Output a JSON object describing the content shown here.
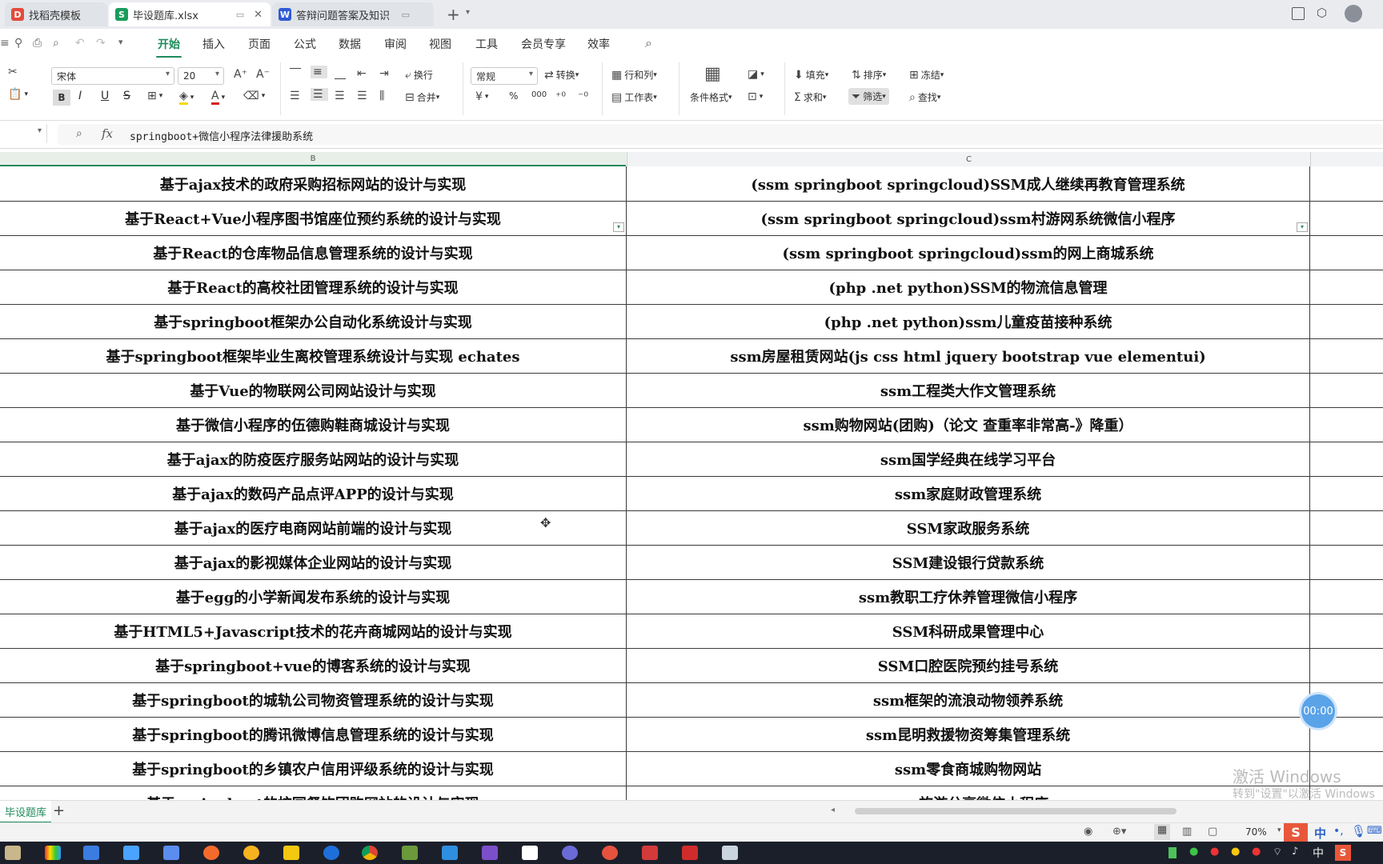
{
  "tabs": [
    {
      "label": "找稻壳模板",
      "icon": "D"
    },
    {
      "label": "毕设题库.xlsx",
      "icon": "S"
    },
    {
      "label": "答辩问题答案及知识",
      "icon": "W"
    }
  ],
  "menu": [
    "开始",
    "插入",
    "页面",
    "公式",
    "数据",
    "审阅",
    "视图",
    "工具",
    "会员专享",
    "效率"
  ],
  "ribbon": {
    "font_name": "宋体",
    "font_size": "20",
    "wrap": "换行",
    "merge": "合并",
    "number_format": "常规",
    "convert": "转换",
    "rows_cols": "行和列",
    "worksheet": "工作表",
    "cond_format": "条件格式",
    "fill": "填充",
    "sort": "排序",
    "freeze": "冻结",
    "sum": "求和",
    "filter": "筛选",
    "find": "查找",
    "bold": "B",
    "italic": "I",
    "underline": "U",
    "strike": "S",
    "currency": "¥",
    "percent": "%",
    "thousands": "000"
  },
  "formula": {
    "fx": "fx",
    "content": "springboot+微信小程序法律援助系统"
  },
  "columns": {
    "b": "B",
    "c": "C"
  },
  "rows": [
    {
      "b": "基于ajax技术的政府采购招标网站的设计与实现",
      "c": "(ssm springboot springcloud)SSM成人继续再教育管理系统"
    },
    {
      "b": "基于React+Vue小程序图书馆座位预约系统的设计与实现",
      "c": "(ssm springboot springcloud)ssm村游网系统微信小程序"
    },
    {
      "b": "基于React的仓库物品信息管理系统的设计与实现",
      "c": "(ssm springboot springcloud)ssm的网上商城系统"
    },
    {
      "b": "基于React的高校社团管理系统的设计与实现",
      "c": "(php .net python)SSM的物流信息管理"
    },
    {
      "b": "基于springboot框架办公自动化系统设计与实现",
      "c": "(php .net python)ssm儿童疫苗接种系统"
    },
    {
      "b": "基于springboot框架毕业生离校管理系统设计与实现 echates",
      "c": "ssm房屋租赁网站(js css html jquery bootstrap vue elementui)"
    },
    {
      "b": "基于Vue的物联网公司网站设计与实现",
      "c": "ssm工程类大作文管理系统"
    },
    {
      "b": "基于微信小程序的伍德购鞋商城设计与实现",
      "c": "ssm购物网站(团购)（论文 查重率非常高-》降重）"
    },
    {
      "b": "基于ajax的防疫医疗服务站网站的设计与实现",
      "c": "ssm国学经典在线学习平台"
    },
    {
      "b": "基于ajax的数码产品点评APP的设计与实现",
      "c": "ssm家庭财政管理系统"
    },
    {
      "b": "基于ajax的医疗电商网站前端的设计与实现",
      "c": "SSM家政服务系统"
    },
    {
      "b": "基于ajax的影视媒体企业网站的设计与实现",
      "c": "SSM建设银行贷款系统"
    },
    {
      "b": "基于egg的小学新闻发布系统的设计与实现",
      "c": "ssm教职工疗休养管理微信小程序"
    },
    {
      "b": "基于HTML5+Javascript技术的花卉商城网站的设计与实现",
      "c": "SSM科研成果管理中心"
    },
    {
      "b": "基于springboot+vue的博客系统的设计与实现",
      "c": "SSM口腔医院预约挂号系统"
    },
    {
      "b": "基于springboot的城轨公司物资管理系统的设计与实现",
      "c": "ssm框架的流浪动物领养系统"
    },
    {
      "b": "基于springboot的腾讯微博信息管理系统的设计与实现",
      "c": "ssm昆明救援物资筹集管理系统"
    },
    {
      "b": "基于springboot的乡镇农户信用评级系统的设计与实现",
      "c": "ssm零食商城购物网站"
    },
    {
      "b": "基于springboot的校园餐饮团购网站的设计与实现",
      "c": "ssm旅游分享微信小程序"
    }
  ],
  "sheet_tab": "毕设题库",
  "zoom": "70%",
  "timer": "00:00",
  "watermark": {
    "line1": "激活 Windows",
    "line2": "转到\"设置\"以激活 Windows"
  },
  "ime": {
    "lang": "中",
    "lang2": "中"
  },
  "colors": {
    "accent": "#1f8a5b",
    "sheet_icon": "#1a9b5c",
    "word_icon": "#2f5bd3",
    "pdf_icon": "#e24b3b"
  }
}
